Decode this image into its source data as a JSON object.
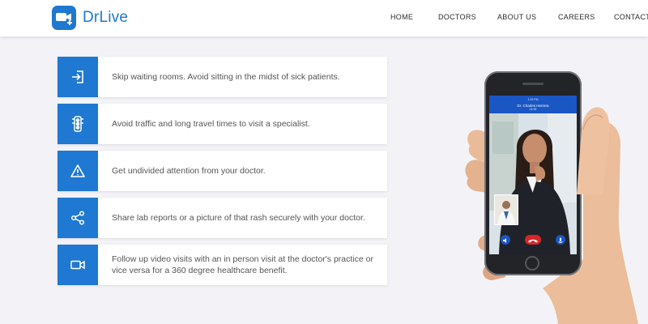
{
  "brand": {
    "name": "DrLive",
    "accent": "#1f78d1"
  },
  "nav": {
    "home": "HOME",
    "doctors": "DOCTORS",
    "about": "ABOUT US",
    "careers": "CAREERS",
    "contact": "CONTACT U"
  },
  "features": [
    {
      "icon": "sign-in-icon",
      "text": "Skip waiting rooms. Avoid sitting in the midst of sick patients."
    },
    {
      "icon": "traffic-light-icon",
      "text": "Avoid traffic and long travel times to visit a specialist."
    },
    {
      "icon": "warning-triangle-icon",
      "text": "Get undivided attention from your doctor."
    },
    {
      "icon": "share-icon",
      "text": "Share lab reports or a picture of that rash securely with your doctor."
    },
    {
      "icon": "video-camera-icon",
      "text": "Follow up video visits with an in person visit at the doctor's practice or vice versa for a 360 degree healthcare benefit."
    }
  ],
  "phone_screen": {
    "status": "1:29 PM",
    "caller": "Dr. Charles Herrera",
    "duration": "01:26"
  }
}
